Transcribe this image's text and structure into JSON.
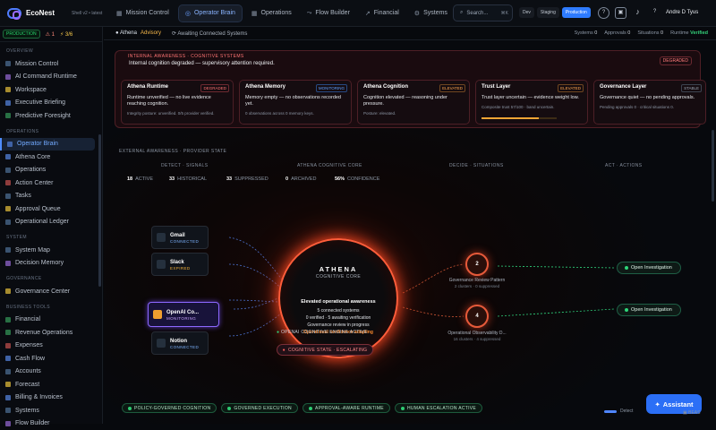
{
  "app": {
    "name": "EcoNest",
    "shell": "Shell v2 • latest"
  },
  "nav": [
    {
      "label": "Mission Control",
      "icon": "grid-icon"
    },
    {
      "label": "Operator Brain",
      "icon": "brain-icon",
      "active": true
    },
    {
      "label": "Operations",
      "icon": "grid-icon"
    },
    {
      "label": "Flow Builder",
      "icon": "flow-icon"
    },
    {
      "label": "Financial",
      "icon": "chart-icon"
    },
    {
      "label": "Systems",
      "icon": "gear-icon"
    }
  ],
  "search": {
    "placeholder": "Search...",
    "shortcut": "⌘K"
  },
  "env": [
    "Dev",
    "Staging",
    "Production"
  ],
  "user": "Andre D Tyus",
  "sidebar": {
    "env_badge": "PRODUCTION",
    "alerts": "1",
    "ratio": "3/6",
    "sections": [
      {
        "title": "OVERVIEW",
        "items": [
          "Mission Control",
          "AI Command Runtime",
          "Workspace",
          "Executive Briefing",
          "Predictive Foresight"
        ]
      },
      {
        "title": "OPERATIONS",
        "items": [
          "Operator Brain",
          "Athena Core",
          "Operations",
          "Action Center",
          "Tasks",
          "Approval Queue",
          "Operational Ledger"
        ]
      },
      {
        "title": "SYSTEM",
        "items": [
          "System Map",
          "Decision Memory"
        ]
      },
      {
        "title": "GOVERNANCE",
        "items": [
          "Governance Center"
        ]
      },
      {
        "title": "BUSINESS TOOLS",
        "items": [
          "Financial",
          "Revenue Operations",
          "Expenses",
          "Cash Flow",
          "Accounts",
          "Forecast",
          "Billing & Invoices",
          "Systems",
          "Flow Builder"
        ]
      }
    ]
  },
  "crumb": {
    "name": "Athena",
    "mode": "Advisory",
    "wait": "Awaiting Connected Systems",
    "status": [
      "Systems",
      "Approvals",
      "Situations"
    ],
    "counts": [
      "0",
      "0",
      "0"
    ],
    "runtime_label": "Runtime",
    "runtime": "Verified"
  },
  "alert": {
    "header": "INTERNAL AWARENESS · COGNITIVE SYSTEMS",
    "title": "Internal cognition degraded — supervisory attention required.",
    "badge": "DEGRADED",
    "cards": [
      {
        "name": "Athena Runtime",
        "status": "DEGRADED",
        "desc": "Runtime unverified — no live evidence reaching cognition.",
        "extra": "Integrity posture: unverified. 0/5 provider verified."
      },
      {
        "name": "Athena Memory",
        "status": "MONITORING",
        "desc": "Memory empty — no observations recorded yet.",
        "extra": "0 observations across 0 memory keys."
      },
      {
        "name": "Athena Cognition",
        "status": "ELEVATED",
        "desc": "Cognition elevated — reasoning under pressure.",
        "extra": "Posture: elevated."
      },
      {
        "name": "Trust Layer",
        "status": "ELEVATED",
        "desc": "Trust layer uncertain — evidence weight low.",
        "extra": "Composite trust 57/100 · band uncertain.",
        "progress": 0.57
      },
      {
        "name": "Governance Layer",
        "status": "STABLE",
        "desc": "Governance quiet — no pending approvals.",
        "extra": "Pending approvals 0 · critical situations 0."
      }
    ]
  },
  "awareness": {
    "title": "EXTERNAL AWARENESS · PROVIDER STATE",
    "cols": [
      "DETECT · SIGNALS",
      "ATHENA COGNITIVE CORE",
      "DECIDE · SITUATIONS",
      "ACT · ACTIONS"
    ],
    "stats": [
      {
        "n": "18",
        "l": "ACTIVE"
      },
      {
        "n": "33",
        "l": "HISTORICAL"
      },
      {
        "n": "33",
        "l": "SUPPRESSED"
      },
      {
        "n": "0",
        "l": "ARCHIVED"
      },
      {
        "n": "56%",
        "l": "CONFIDENCE"
      }
    ]
  },
  "providers": [
    {
      "name": "Gmail",
      "state": "CONNECTED"
    },
    {
      "name": "Slack",
      "state": "EXPIRED"
    },
    {
      "name": "OpenAI Co...",
      "state": "MONITORING"
    },
    {
      "name": "Notion",
      "state": "CONNECTED"
    }
  ],
  "core": {
    "title": "ATHENA",
    "subtitle": "COGNITIVE CORE",
    "lines": [
      "Elevated operational awareness",
      "5 connected systems",
      "0 verified · 5 awaiting verification",
      "Governance review in progress",
      "Operational confidence adapting"
    ],
    "engine": "OPENAI COGNITIVE ENGINE ACTIVE",
    "state": "COGNITIVE STATE · ESCALATING"
  },
  "situations": [
    {
      "count": "2",
      "name": "Governance Review Pattern",
      "detail": "2 clusters · 0 suppressed"
    },
    {
      "count": "4",
      "name": "Operational Observability D...",
      "detail": "16 clusters · 4 suppressed"
    }
  ],
  "actions": [
    "Open Investigation",
    "Open Investigation"
  ],
  "pills": [
    "POLICY-GOVERNED COGNITION",
    "GOVERNED EXECUTION",
    "APPROVAL-AWARE RUNTIME",
    "HUMAN ESCALATION ACTIVE"
  ],
  "legend": "Detect",
  "assistant": "Assistant",
  "beas": "BEAS"
}
